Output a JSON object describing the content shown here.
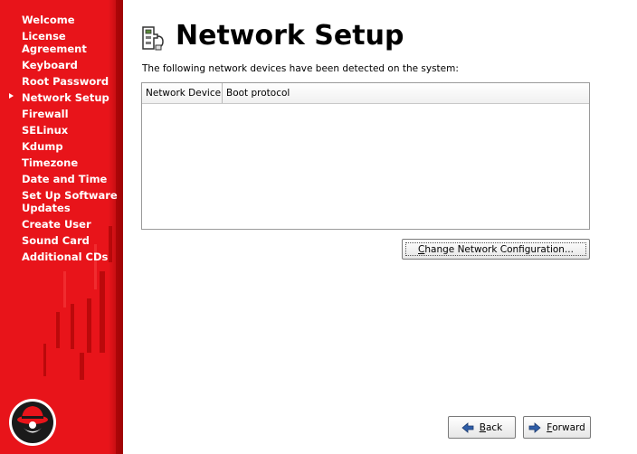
{
  "sidebar": {
    "items": [
      {
        "label": "Welcome"
      },
      {
        "label": "License Agreement"
      },
      {
        "label": "Keyboard"
      },
      {
        "label": "Root Password"
      },
      {
        "label": "Network Setup"
      },
      {
        "label": "Firewall"
      },
      {
        "label": "SELinux"
      },
      {
        "label": "Kdump"
      },
      {
        "label": "Timezone"
      },
      {
        "label": "Date and Time"
      },
      {
        "label": "Set Up Software Updates"
      },
      {
        "label": "Create User"
      },
      {
        "label": "Sound Card"
      },
      {
        "label": "Additional CDs"
      }
    ],
    "active_item": "Network Setup",
    "logo_icon": "redhat-shadowman-logo"
  },
  "main": {
    "title": "Network Setup",
    "title_icon": "network-card-icon",
    "description": "The following network devices have been detected on the system:",
    "table": {
      "columns": [
        "Network Device",
        "Boot protocol"
      ],
      "rows": []
    },
    "change_button": {
      "mnemonic": "C",
      "rest": "hange Network Configuration..."
    }
  },
  "footer": {
    "back": {
      "mnemonic": "B",
      "rest": "ack",
      "icon": "arrow-left-icon"
    },
    "forward": {
      "mnemonic": "F",
      "rest": "orward",
      "icon": "arrow-right-icon"
    }
  },
  "colors": {
    "sidebar_red": "#e8141a",
    "arrow_blue": "#2f5ea8"
  }
}
